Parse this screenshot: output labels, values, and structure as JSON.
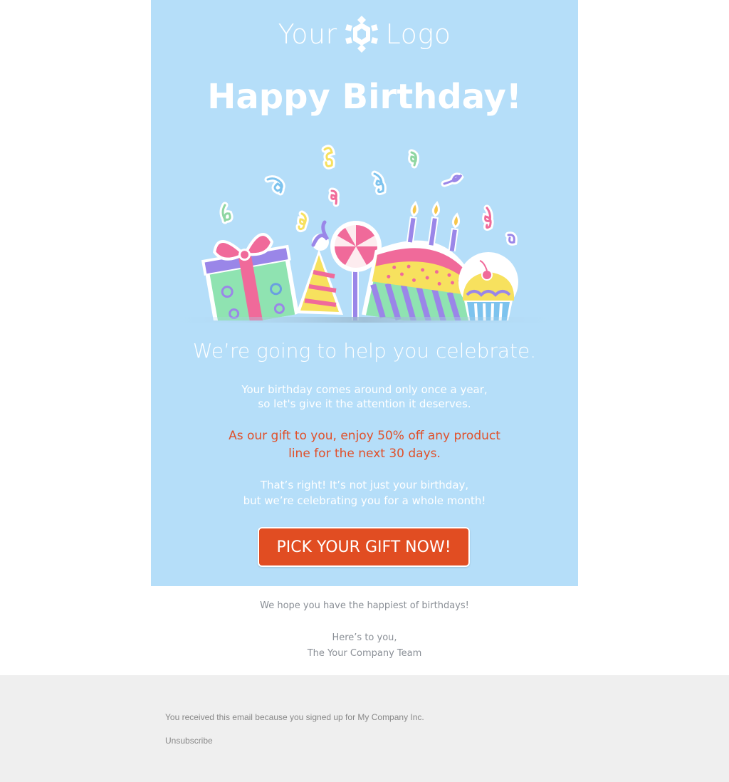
{
  "colors": {
    "card_background": "#b5def9",
    "accent_orange": "#e14d22",
    "offer_text": "#e0502a",
    "footer_background": "#efefef"
  },
  "header": {
    "logo_left": "Your",
    "logo_right": "Logo",
    "logo_icon": "hexagon-flower-icon"
  },
  "hero": {
    "title": "Happy Birthday!",
    "illustration": "birthday-party-illustration"
  },
  "body": {
    "subheading": "We’re going to help you celebrate.",
    "intro_line1": "Your birthday comes around only once a year,",
    "intro_line2": "so let's give it the attention it deserves.",
    "offer_line1": "As our gift to you, enjoy 50% off any product",
    "offer_line2": "line for the next 30 days.",
    "celebrate_line1": "That’s right! It’s not just your birthday,",
    "celebrate_line2": "but we’re celebrating you for a whole month!",
    "cta_label": "PICK YOUR GIFT NOW!"
  },
  "closing": {
    "hope": "We hope you have the happiest of birthdays!",
    "signoff": "Here’s to you,",
    "team": "The Your Company Team"
  },
  "footer": {
    "note": "You received this email because you signed up for My Company Inc.",
    "unsubscribe": "Unsubscribe"
  }
}
